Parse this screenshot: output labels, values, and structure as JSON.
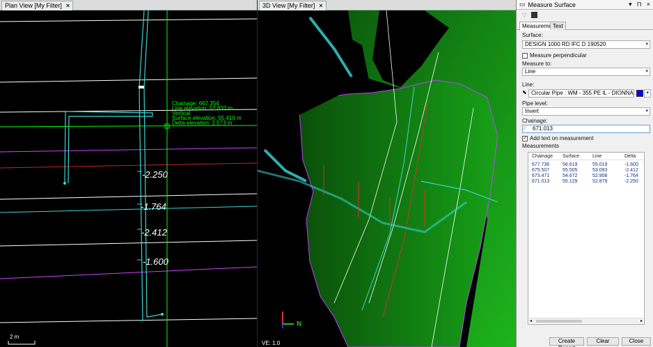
{
  "plan_view": {
    "tab_title": "Plan View [My Filter]",
    "annotation": [
      "Chainage: 667.354",
      "Line elevation: 52.837 m",
      "Vertical",
      "Surface elevation: 55.410 m",
      "Delta elevation: 2.573 m"
    ],
    "delta_labels": [
      "-2.250",
      "-1.764",
      "-2.412",
      "-1.600"
    ],
    "scale_label": "2 m"
  },
  "view_3d": {
    "tab_title": "3D View [My Filter]",
    "ve_label": "VE: 1.0",
    "north_label": "N"
  },
  "panel": {
    "title": "Measure Surface",
    "tabs": [
      "Measurement",
      "Text"
    ],
    "surface_label": "Surface:",
    "surface_value": "DESIGN 1000 RD IFC D 190520",
    "measure_perpendicular": "Measure perpendicular",
    "measure_to_label": "Measure to:",
    "measure_to_value": "Line",
    "line_label": "Line:",
    "line_value": "Circular Pipe : WM - 355 PE IL - DIONNA",
    "line_color": "#0000ff",
    "pipe_level_label": "Pipe level:",
    "pipe_level_value": "Invert",
    "chainage_label": "Chainage:",
    "chainage_value": "671.013",
    "add_text_label": "Add text on measurement",
    "add_text_checked": "✓",
    "measurements_label": "Measurements",
    "columns": [
      "Chainage",
      "Surface",
      "Line",
      "Delta"
    ],
    "rows": [
      [
        "677.736",
        "56.619",
        "55.019",
        "-1.600"
      ],
      [
        "675.507",
        "55.505",
        "53.093",
        "-2.412"
      ],
      [
        "673.471",
        "54.672",
        "52.908",
        "-1.764"
      ],
      [
        "671.013",
        "55.129",
        "52.879",
        "-2.250"
      ]
    ],
    "buttons": {
      "create_report": "Create Report",
      "clear": "Clear",
      "close": "Close"
    }
  },
  "colors": {
    "accent_green": "#00ff00",
    "pipe_cyan": "#39d7d7",
    "terrain_green": "#0d7a0d"
  }
}
